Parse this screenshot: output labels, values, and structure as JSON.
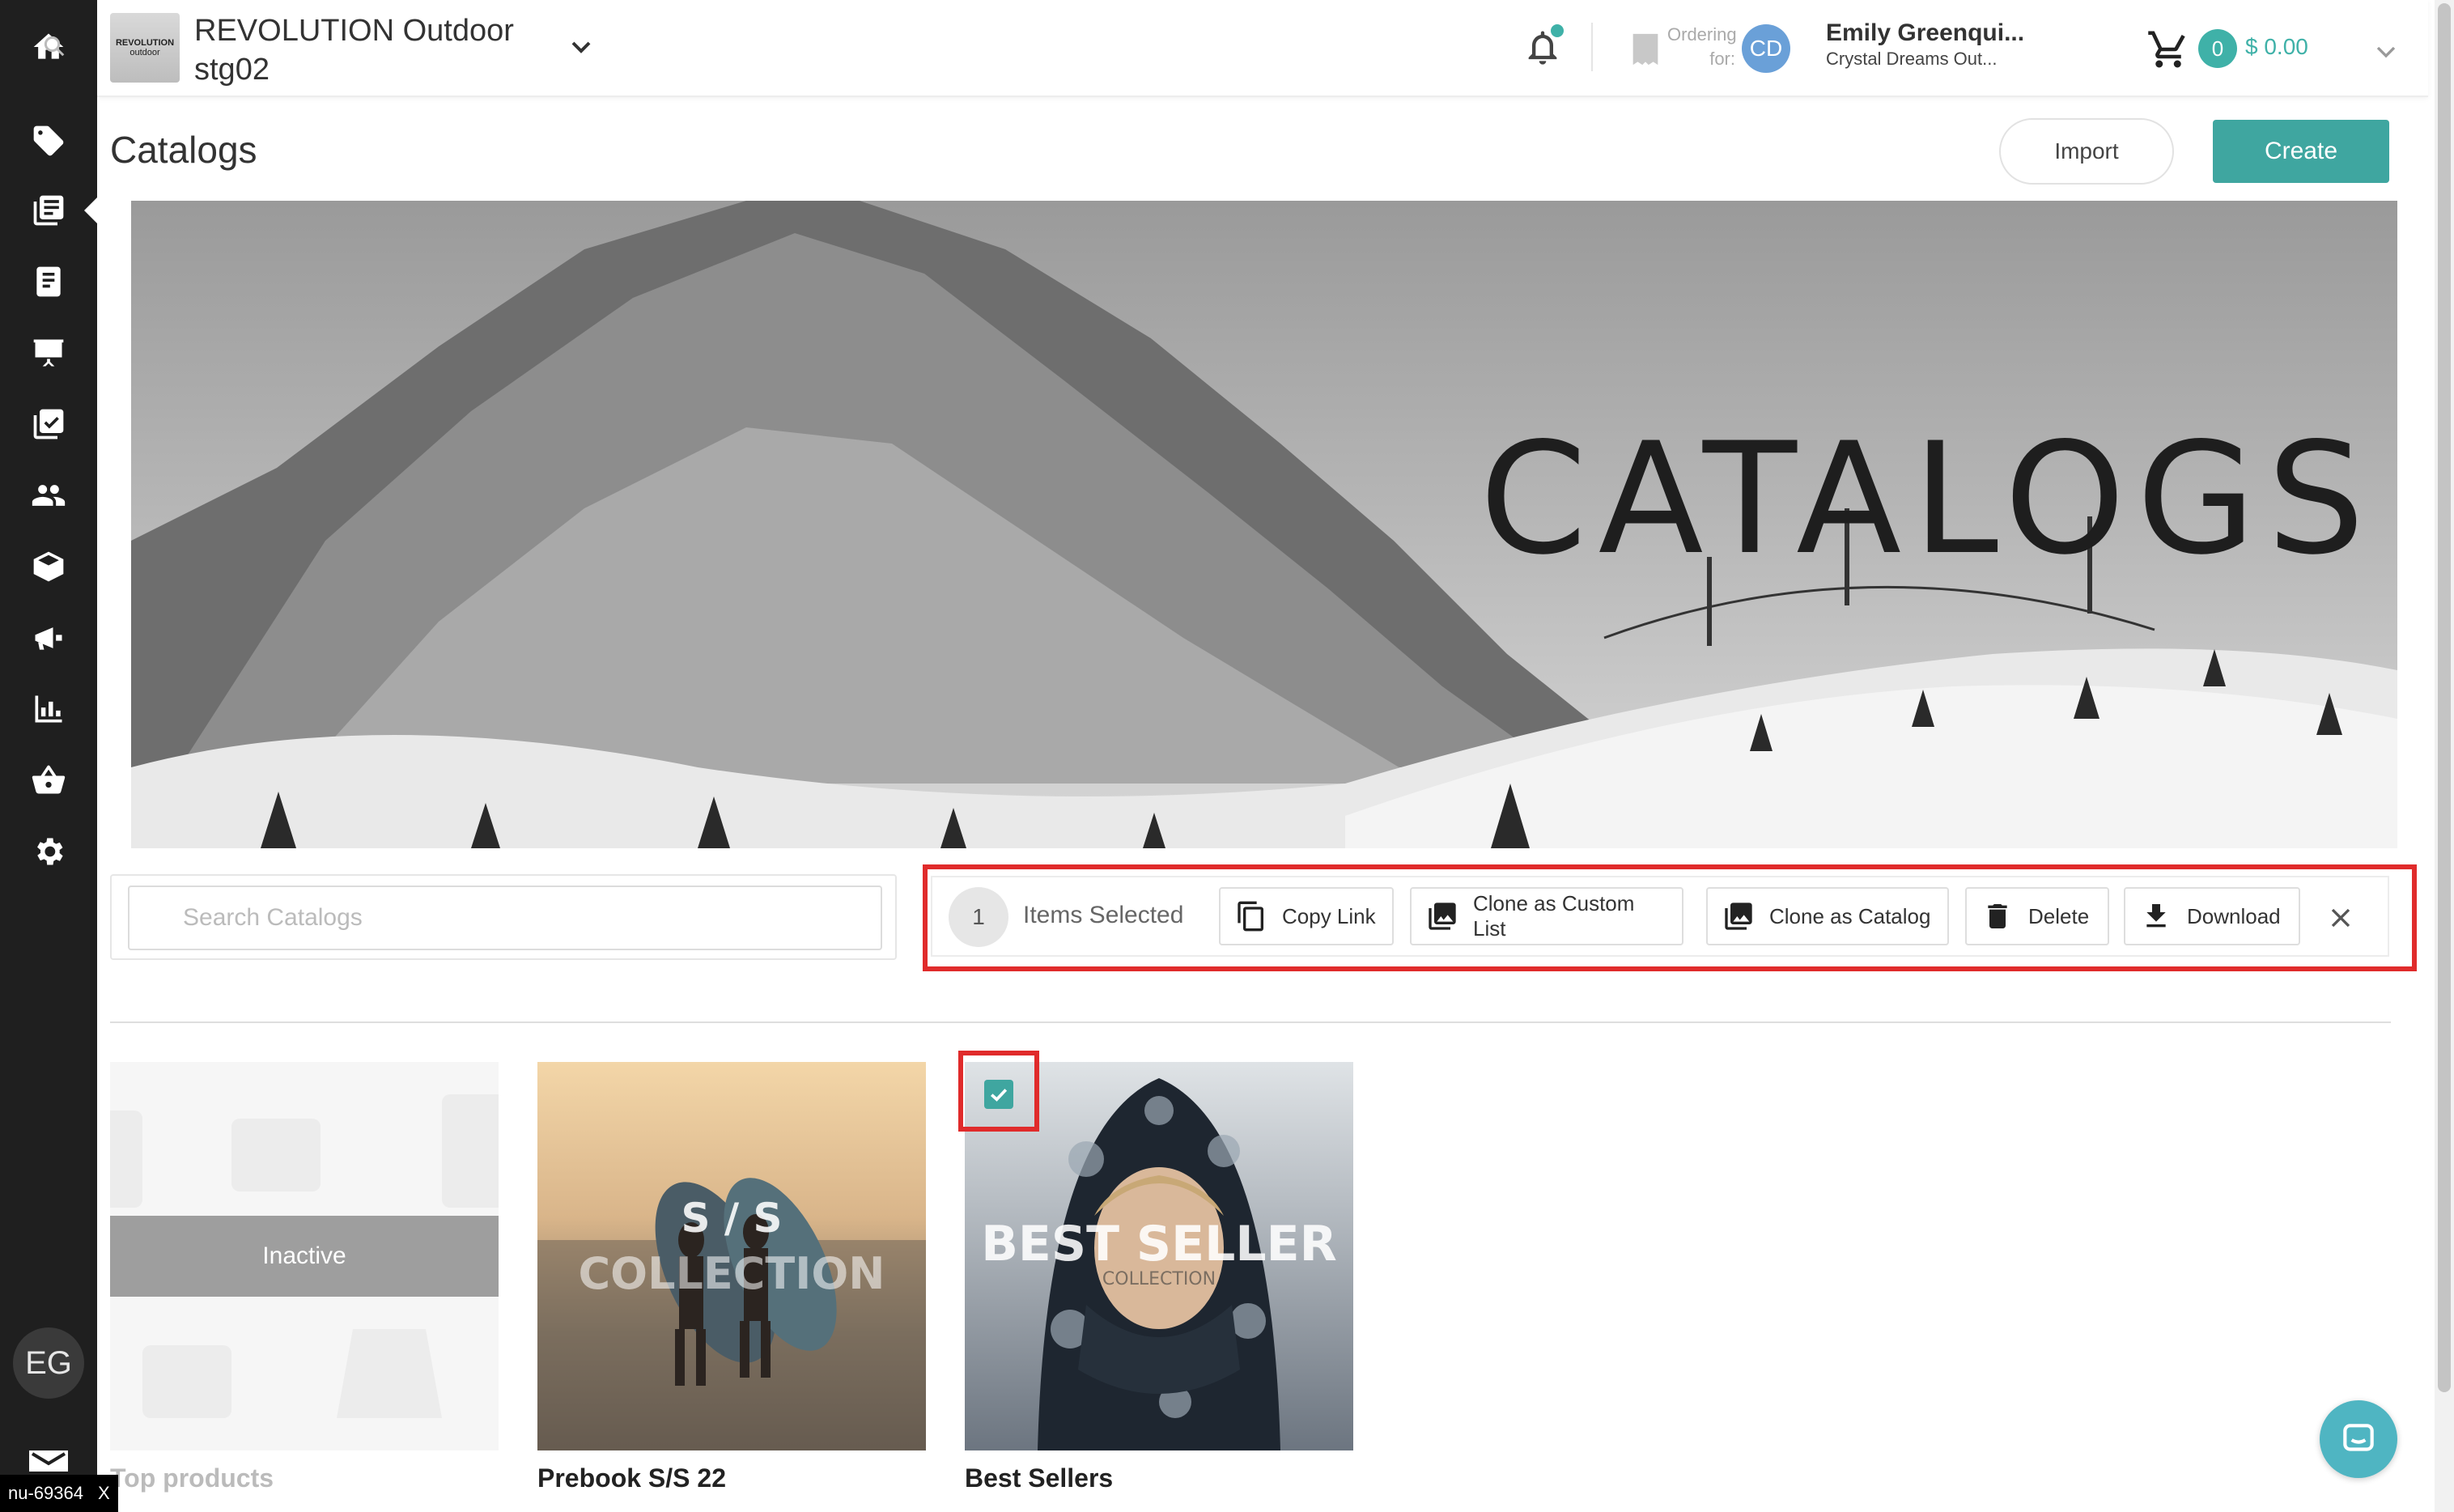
{
  "sidebar": {
    "items": [
      {
        "icon": "home-icon"
      },
      {
        "icon": "tag-icon"
      },
      {
        "icon": "catalogs-icon"
      },
      {
        "icon": "orders-icon"
      },
      {
        "icon": "presentation-icon"
      },
      {
        "icon": "checklist-icon"
      },
      {
        "icon": "customers-icon"
      },
      {
        "icon": "products-icon"
      },
      {
        "icon": "marketing-icon"
      },
      {
        "icon": "reports-icon"
      },
      {
        "icon": "basket-icon"
      },
      {
        "icon": "settings-icon"
      }
    ],
    "user_initials": "EG",
    "env_tag": "nu-69364",
    "env_close": "X"
  },
  "topbar": {
    "brand_logo_line1": "REVOLUTION",
    "brand_logo_line2": "outdoor",
    "brand_name": "REVOLUTION Outdoor stg02",
    "ordering_label": "Ordering for:",
    "customer_initials": "CD",
    "user_name": "Emily Greenqui...",
    "user_company": "Crystal Dreams Out...",
    "cart_count": "0",
    "cart_total": "$ 0.00",
    "accent_color": "#3fb1a8"
  },
  "page": {
    "title": "Catalogs",
    "import_label": "Import",
    "create_label": "Create",
    "banner_title": "CATALOGS"
  },
  "search": {
    "placeholder": "Search Catalogs",
    "value": ""
  },
  "selection_bar": {
    "count": "1",
    "label": "Items Selected",
    "actions": [
      {
        "label": "Copy Link",
        "icon": "copy-icon"
      },
      {
        "label": "Clone as Custom List",
        "icon": "image-stack-icon"
      },
      {
        "label": "Clone as Catalog",
        "icon": "image-stack-icon"
      },
      {
        "label": "Delete",
        "icon": "trash-icon"
      },
      {
        "label": "Download",
        "icon": "download-icon"
      }
    ],
    "close_icon": "close-icon"
  },
  "catalogs": [
    {
      "name": "Top products",
      "status": "Inactive",
      "overlay_line1": "",
      "overlay_line2": "",
      "selected": false
    },
    {
      "name": "Prebook S/S 22",
      "status": "",
      "overlay_line1": "S / S",
      "overlay_line2": "COLLECTION",
      "selected": false
    },
    {
      "name": "Best Sellers",
      "status": "",
      "overlay_line1": "BEST SELLER",
      "overlay_line2": "COLLECTION",
      "selected": true
    }
  ],
  "colors": {
    "primary": "#3fa6a0",
    "highlight": "#e02b2b",
    "sidebar_bg": "#1f1f1f"
  }
}
